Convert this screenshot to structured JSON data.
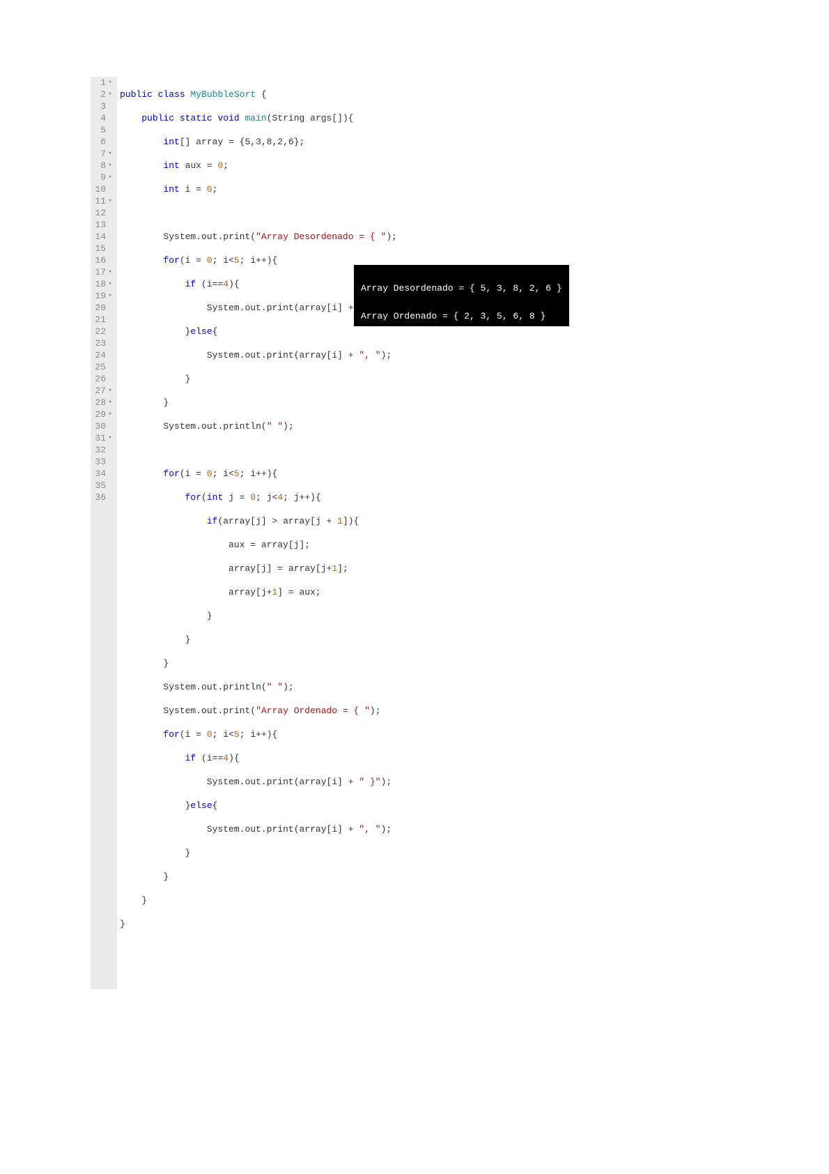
{
  "editor": {
    "lines": [
      {
        "num": "1",
        "fold": true
      },
      {
        "num": "2",
        "fold": true
      },
      {
        "num": "3",
        "fold": false
      },
      {
        "num": "4",
        "fold": false
      },
      {
        "num": "5",
        "fold": false
      },
      {
        "num": "6",
        "fold": false
      },
      {
        "num": "7",
        "fold": true
      },
      {
        "num": "8",
        "fold": true
      },
      {
        "num": "9",
        "fold": true
      },
      {
        "num": "10",
        "fold": false
      },
      {
        "num": "11",
        "fold": true
      },
      {
        "num": "12",
        "fold": false
      },
      {
        "num": "13",
        "fold": false
      },
      {
        "num": "14",
        "fold": false
      },
      {
        "num": "15",
        "fold": false
      },
      {
        "num": "16",
        "fold": false
      },
      {
        "num": "17",
        "fold": true
      },
      {
        "num": "18",
        "fold": true
      },
      {
        "num": "19",
        "fold": true
      },
      {
        "num": "20",
        "fold": false
      },
      {
        "num": "21",
        "fold": false
      },
      {
        "num": "22",
        "fold": false
      },
      {
        "num": "23",
        "fold": false
      },
      {
        "num": "24",
        "fold": false
      },
      {
        "num": "25",
        "fold": false
      },
      {
        "num": "26",
        "fold": false
      },
      {
        "num": "27",
        "fold": true
      },
      {
        "num": "28",
        "fold": true
      },
      {
        "num": "29",
        "fold": true
      },
      {
        "num": "30",
        "fold": false
      },
      {
        "num": "31",
        "fold": true
      },
      {
        "num": "32",
        "fold": false
      },
      {
        "num": "33",
        "fold": false
      },
      {
        "num": "34",
        "fold": false
      },
      {
        "num": "35",
        "fold": false
      },
      {
        "num": "36",
        "fold": false
      }
    ]
  },
  "tokens": {
    "kw_public": "public",
    "kw_class": "class",
    "kw_static": "static",
    "kw_void": "void",
    "kw_int": "int",
    "kw_for": "for",
    "kw_if": "if",
    "kw_else": "else",
    "cls_name": "MyBubbleSort",
    "mth_main": "main",
    "id_String": "String",
    "id_args": "args",
    "id_array": "array",
    "id_aux": "aux",
    "id_i": "i",
    "id_j": "j",
    "id_System": "System",
    "id_out": "out",
    "id_print": "print",
    "id_println": "println",
    "n0": "0",
    "n1": "1",
    "n4": "4",
    "n5": "5",
    "arr_init": "{5,3,8,2,6}",
    "s_desordenado": "\"Array Desordenado = { \"",
    "s_close": "\" }\"",
    "s_comma": "\", \"",
    "s_space": "\" \"",
    "s_ordenado": "\"Array Ordenado = { \""
  },
  "output": {
    "line1": "Array Desordenado = { 5, 3, 8, 2, 6 }",
    "blank": " ",
    "line2": "Array Ordenado = { 2, 3, 5, 6, 8 }"
  }
}
